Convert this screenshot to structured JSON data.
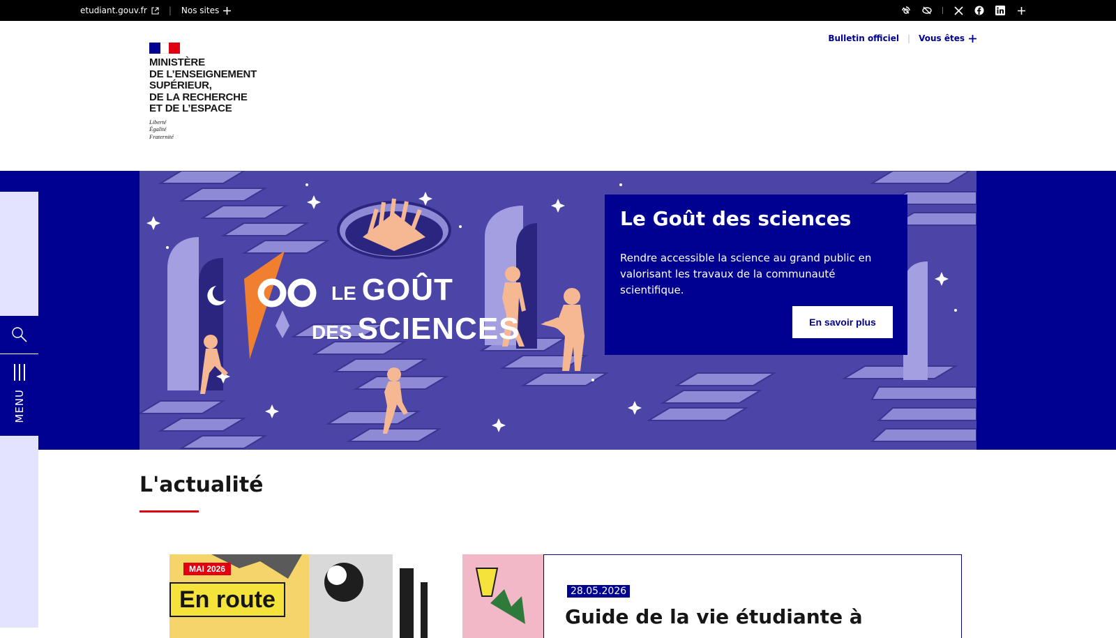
{
  "topbar": {
    "site_link": "etudiant.gouv.fr",
    "nos_sites": "Nos sites",
    "icons": [
      "contrast-icon",
      "hide-icon",
      "x-twitter-icon",
      "facebook-icon",
      "linkedin-icon",
      "plus-icon"
    ]
  },
  "header": {
    "ministry": "MINISTÈRE\nDE L’ENSEIGNEMENT\nSUPÉRIEUR,\nDE LA RECHERCHE\nET DE L’ESPACE",
    "motto": "Liberté\nÉgalité\nFraternité",
    "links": {
      "bulletin": "Bulletin officiel",
      "vous_etes": "Vous êtes"
    }
  },
  "hero": {
    "art_title_line1_small": "LE",
    "art_title_line1_big": "GOÛT",
    "art_title_line2_small": "DES",
    "art_title_line2_big": "SCIENCES",
    "card_title": "Le Goût des sciences",
    "card_text": "Rendre accessible la science au grand public en valorisant les travaux de la communauté scientifique.",
    "button": "En savoir plus"
  },
  "rail": {
    "menu_label": "MENU"
  },
  "news": {
    "section_title": "L'actualité",
    "card": {
      "image_tag": "MAI 2026",
      "image_title": "En route",
      "date": "28.05.2026",
      "title": "Guide de la vie étudiante à"
    }
  },
  "colors": {
    "primary": "#000091",
    "accent_red": "#e1000f",
    "hero_purple": "#4a45a6",
    "rail_light": "#e3e3fd"
  }
}
